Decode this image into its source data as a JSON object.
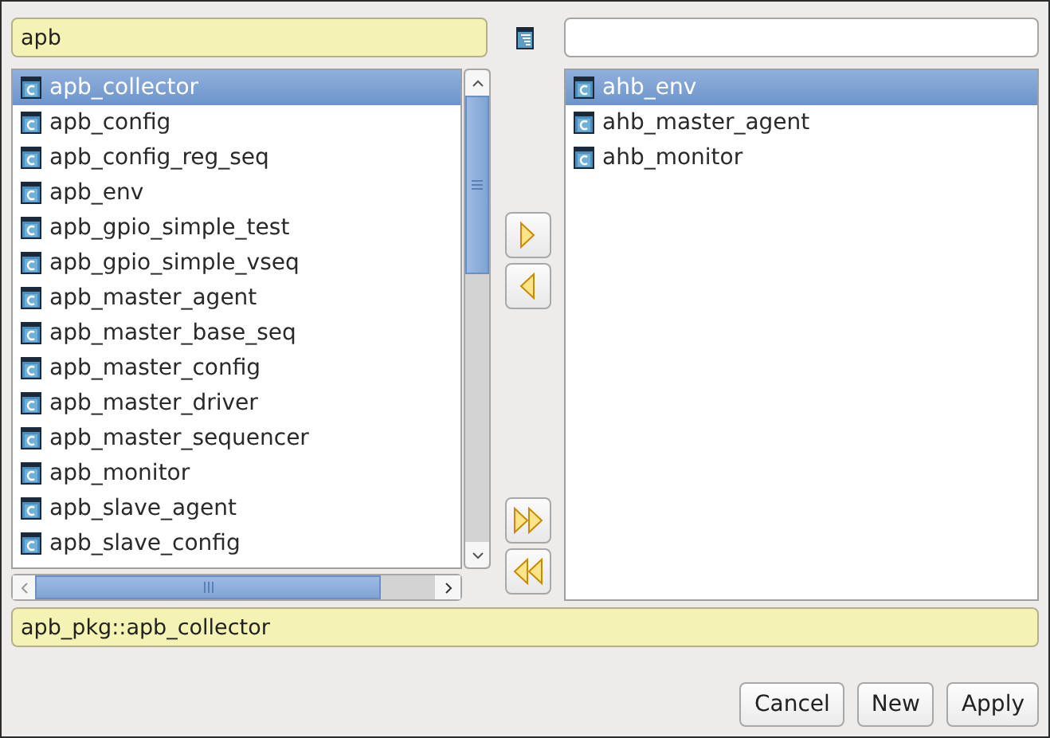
{
  "filter_field": {
    "value": "apb"
  },
  "available_list": [
    {
      "label": "apb_collector",
      "selected": true
    },
    {
      "label": "apb_config",
      "selected": false
    },
    {
      "label": "apb_config_reg_seq",
      "selected": false
    },
    {
      "label": "apb_env",
      "selected": false
    },
    {
      "label": "apb_gpio_simple_test",
      "selected": false
    },
    {
      "label": "apb_gpio_simple_vseq",
      "selected": false
    },
    {
      "label": "apb_master_agent",
      "selected": false
    },
    {
      "label": "apb_master_base_seq",
      "selected": false
    },
    {
      "label": "apb_master_config",
      "selected": false
    },
    {
      "label": "apb_master_driver",
      "selected": false
    },
    {
      "label": "apb_master_sequencer",
      "selected": false
    },
    {
      "label": "apb_monitor",
      "selected": false
    },
    {
      "label": "apb_slave_agent",
      "selected": false
    },
    {
      "label": "apb_slave_config",
      "selected": false
    }
  ],
  "selected_list": [
    {
      "label": "ahb_env",
      "selected": true
    },
    {
      "label": "ahb_master_agent",
      "selected": false
    },
    {
      "label": "ahb_monitor",
      "selected": false
    }
  ],
  "info_field": {
    "value": "apb_pkg::apb_collector"
  },
  "buttons": [
    {
      "label": "Cancel"
    },
    {
      "label": "New"
    },
    {
      "label": "Apply"
    }
  ]
}
